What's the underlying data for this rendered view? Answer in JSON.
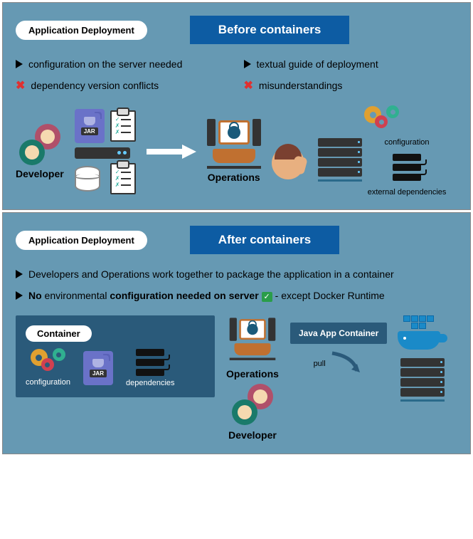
{
  "before": {
    "badge": "Application Deployment",
    "title": "Before containers",
    "bullets": [
      {
        "icon": "tri",
        "text": "configuration on the server needed"
      },
      {
        "icon": "tri",
        "text": "textual guide of deployment"
      },
      {
        "icon": "cross",
        "text": "dependency version conflicts"
      },
      {
        "icon": "cross",
        "text": "misunderstandings"
      }
    ],
    "dev_label": "Developer",
    "ops_label": "Operations",
    "jar_label": "JAR",
    "config_label": "configuration",
    "deps_label": "external dependencies"
  },
  "after": {
    "badge": "Application Deployment",
    "title": "After containers",
    "bullets": [
      {
        "icon": "tri",
        "html": "Developers and Operations work together to package the application in a container"
      },
      {
        "icon": "tri",
        "html": "<b>No</b> environmental <b>configuration needed on server</b> <span class='check'>✓</span> - except Docker Runtime"
      }
    ],
    "container_label": "Container",
    "config_label": "configuration",
    "deps_label": "dependencies",
    "jar_label": "JAR",
    "ops_label": "Operations",
    "dev_label": "Developer",
    "java_box": "Java App Container",
    "pull_label": "pull"
  }
}
